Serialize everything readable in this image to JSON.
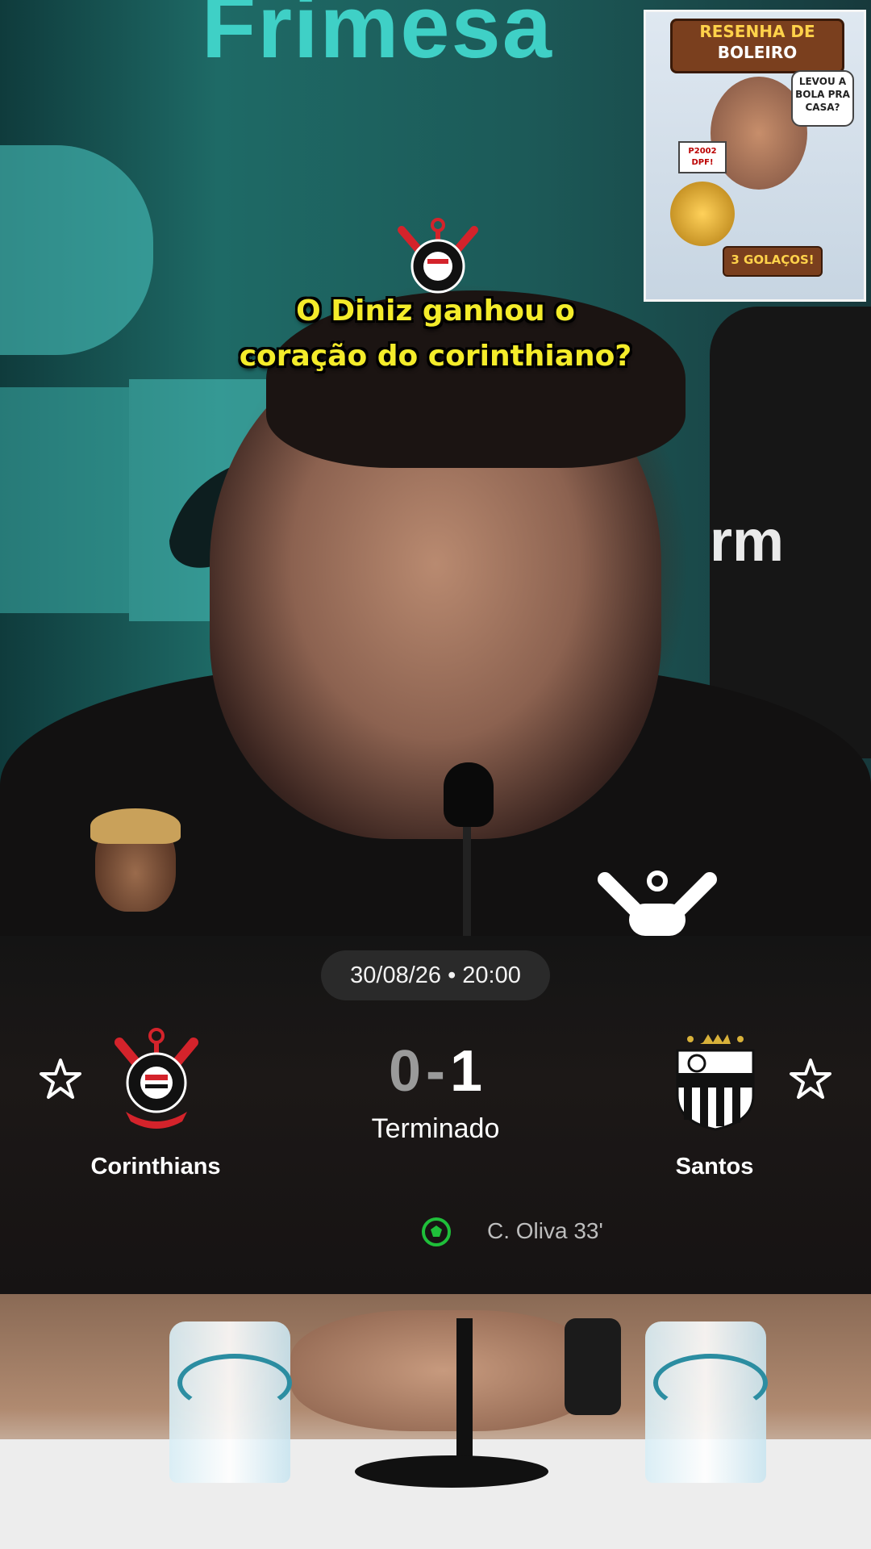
{
  "caption": {
    "line1": "O Diniz ganhou o",
    "line2": "coração do corinthiano?"
  },
  "background": {
    "sponsor_text": "Frimesa",
    "chair_text": "rm"
  },
  "thumbnail": {
    "title_line1": "RESENHA DE",
    "title_line2": "BOLEIRO",
    "bubble_line1": "LEVOU A",
    "bubble_line2": "BOLA PRA",
    "bubble_line3": "CASA?",
    "sign_line1": "P2002",
    "sign_line2": "DPF!",
    "badge": "3 GOLAÇOS!"
  },
  "match": {
    "datetime": "30/08/26 • 20:00",
    "home_team": "Corinthians",
    "away_team": "Santos",
    "home_score": "0",
    "separator": "-",
    "away_score": "1",
    "status": "Terminado",
    "scorer": "C. Oliva 33'"
  },
  "colors": {
    "caption": "#f4ec2a",
    "goal_icon": "#1fbf3a",
    "corinthians_red": "#d4232b",
    "panel_bg": "#161313"
  },
  "icons": {
    "favorite": "star-outline-icon",
    "goal": "soccer-ball-icon"
  }
}
